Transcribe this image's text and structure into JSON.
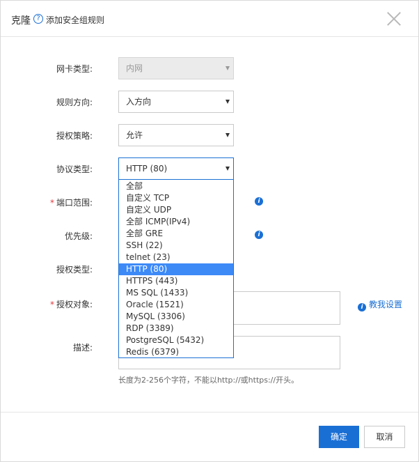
{
  "dialog": {
    "title": "克隆",
    "help_icon": "?",
    "subtitle": "添加安全组规则"
  },
  "form": {
    "nic_type": {
      "label": "网卡类型:",
      "value": "内网",
      "disabled": true
    },
    "direction": {
      "label": "规则方向:",
      "value": "入方向"
    },
    "policy": {
      "label": "授权策略:",
      "value": "允许"
    },
    "protocol": {
      "label": "协议类型:",
      "value": "HTTP (80)",
      "options": [
        "全部",
        "自定义 TCP",
        "自定义 UDP",
        "全部 ICMP(IPv4)",
        "全部 GRE",
        "SSH (22)",
        "telnet (23)",
        "HTTP (80)",
        "HTTPS (443)",
        "MS SQL (1433)",
        "Oracle (1521)",
        "MySQL (3306)",
        "RDP (3389)",
        "PostgreSQL (5432)",
        "Redis (6379)"
      ],
      "selected_index": 7
    },
    "port_range": {
      "label": "端口范围:",
      "required": "*"
    },
    "priority": {
      "label": "优先级:"
    },
    "auth_type": {
      "label": "授权类型:"
    },
    "auth_object": {
      "label": "授权对象:",
      "required": "*",
      "tutorial_link": "教我设置"
    },
    "description": {
      "label": "描述:",
      "hint": "长度为2-256个字符，不能以http://或https://开头。"
    }
  },
  "footer": {
    "confirm_label": "确定",
    "cancel_label": "取消"
  },
  "icons": {
    "info_glyph": "i"
  },
  "colors": {
    "accent": "#1a6fd4",
    "selected_option": "#3d8af7",
    "required": "#e4393c"
  }
}
